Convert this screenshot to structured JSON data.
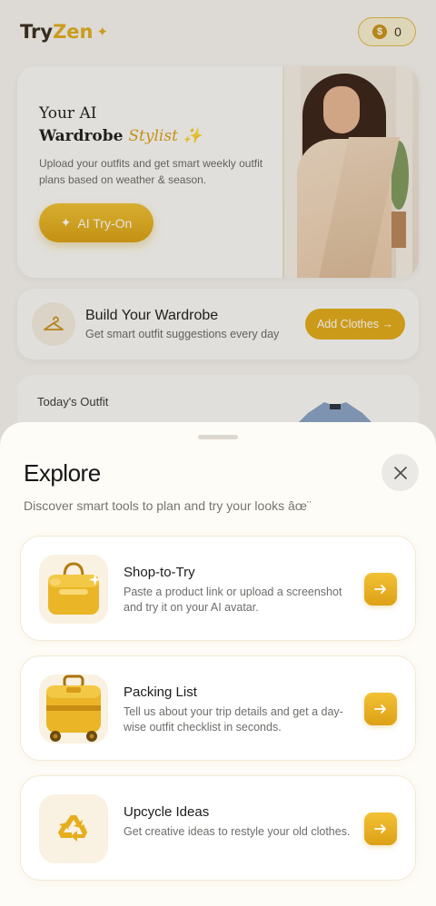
{
  "header": {
    "logo_try": "Try",
    "logo_zen": "Zen",
    "coins": "0"
  },
  "hero": {
    "title_line1": "Your AI",
    "title_line2": "Wardrobe",
    "title_accent": "Stylist ✨",
    "description": "Upload your outfits and get smart weekly outfit plans based on weather & season.",
    "tryon_label": "AI Try-On"
  },
  "wardrobe": {
    "title": "Build Your Wardrobe",
    "subtitle": "Get smart outfit suggestions every day",
    "button_label": "Add Clothes →"
  },
  "outfit": {
    "label": "Today's Outfit"
  },
  "explore": {
    "title": "Explore",
    "subtitle": "Discover smart tools to plan and try your looks âœ¨",
    "tools": [
      {
        "title": "Shop-to-Try",
        "description": "Paste a product link or upload a screenshot and try it on your AI avatar.",
        "icon": "shopping-bag-icon"
      },
      {
        "title": "Packing List",
        "description": "Tell us about your trip details and get a day-wise outfit checklist in seconds.",
        "icon": "suitcase-icon"
      },
      {
        "title": "Upcycle Ideas",
        "description": "Get creative ideas to restyle your old clothes.",
        "icon": "recycle-icon"
      }
    ]
  },
  "colors": {
    "accent": "#e2ab1a",
    "sheet_bg": "#fefcf7",
    "card_bg": "#ffffff"
  }
}
